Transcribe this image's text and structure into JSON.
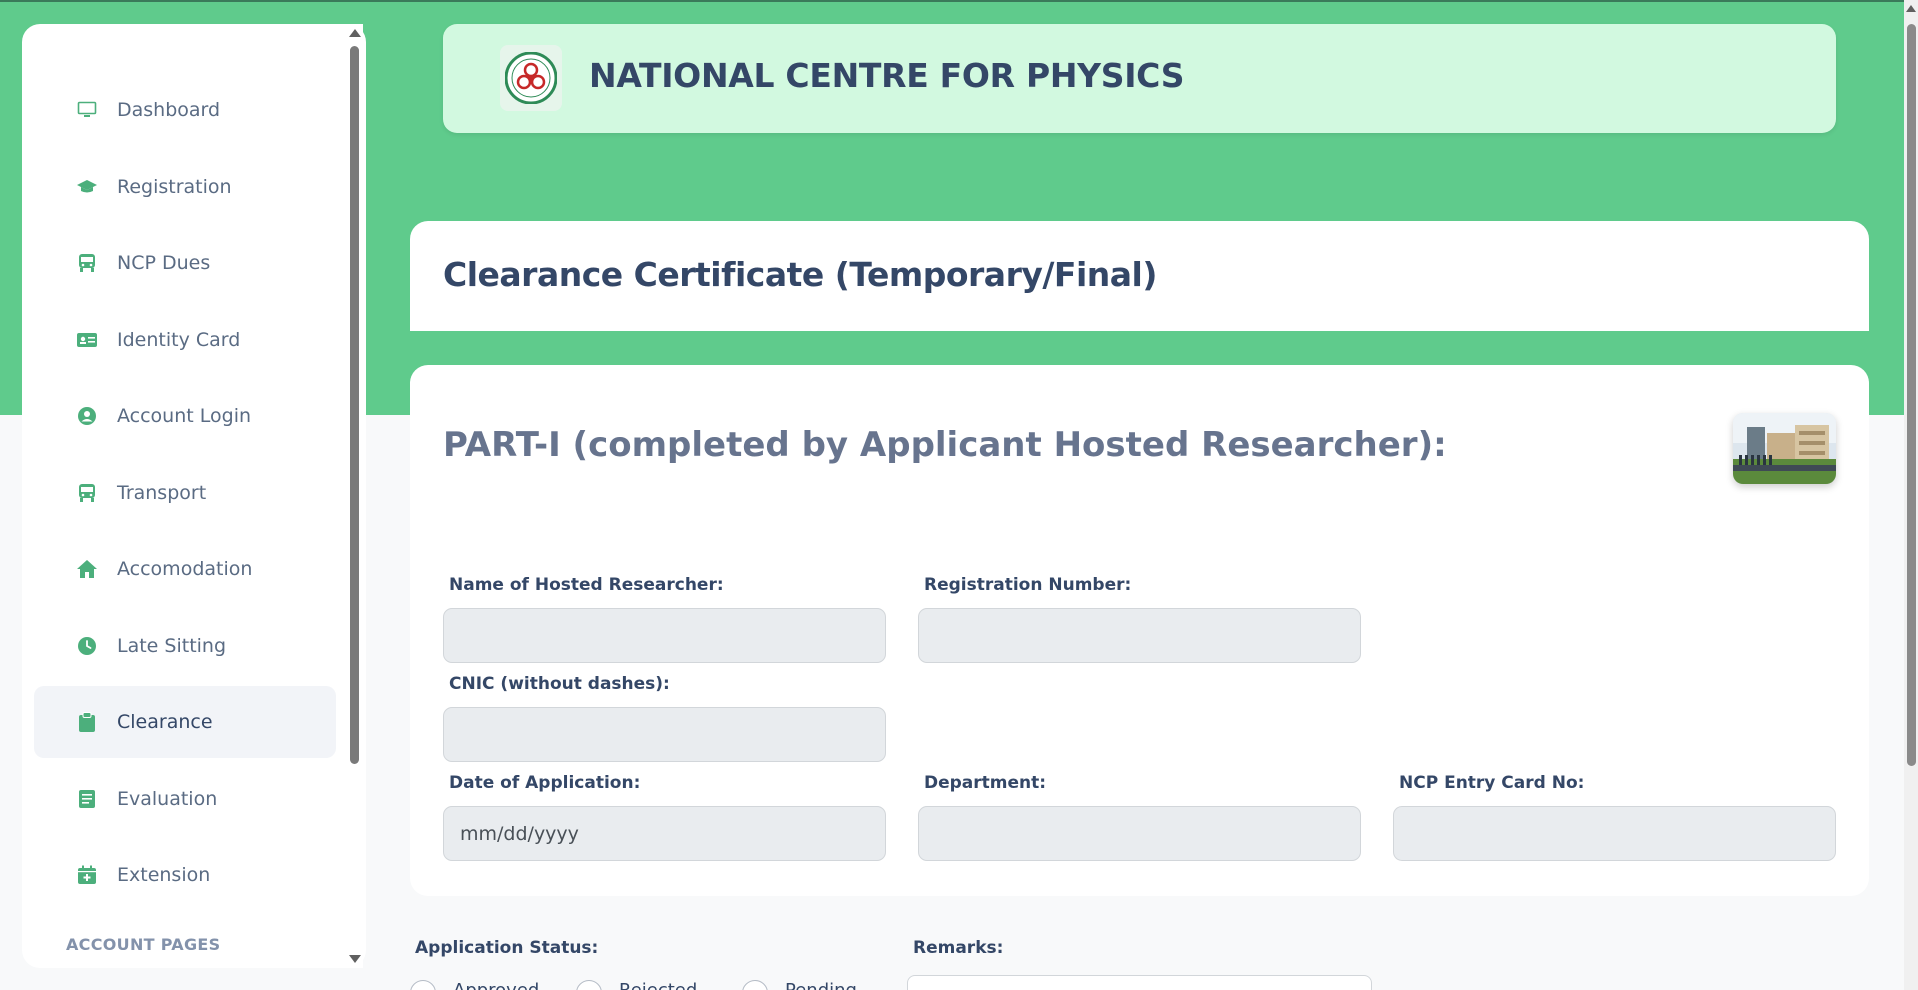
{
  "header": {
    "title": "NATIONAL CENTRE FOR PHYSICS"
  },
  "sidebar": {
    "items": [
      {
        "label": "Dashboard",
        "icon": "monitor-icon"
      },
      {
        "label": "Registration",
        "icon": "graduation-cap-icon"
      },
      {
        "label": "NCP Dues",
        "icon": "bus-icon"
      },
      {
        "label": "Identity Card",
        "icon": "id-card-icon"
      },
      {
        "label": "Account Login",
        "icon": "user-circle-icon"
      },
      {
        "label": "Transport",
        "icon": "bus-icon"
      },
      {
        "label": "Accomodation",
        "icon": "home-icon"
      },
      {
        "label": "Late Sitting",
        "icon": "clock-icon"
      },
      {
        "label": "Clearance",
        "icon": "clipboard-icon",
        "active": true
      },
      {
        "label": "Evaluation",
        "icon": "book-icon"
      },
      {
        "label": "Extension",
        "icon": "calendar-plus-icon"
      }
    ],
    "section_label": "ACCOUNT PAGES"
  },
  "page": {
    "title": "Clearance Certificate (Temporary/Final)",
    "part_title": "PART-I (completed by Applicant Hosted Researcher):"
  },
  "form": {
    "name_label": "Name of Hosted Researcher:",
    "name_value": "",
    "reg_label": "Registration Number:",
    "reg_value": "",
    "cnic_label": "CNIC (without dashes):",
    "cnic_value": "",
    "date_label": "Date of Application:",
    "date_value": "mm/dd/yyyy",
    "dept_label": "Department:",
    "dept_value": "",
    "entry_label": "NCP Entry Card No:",
    "entry_value": ""
  },
  "status": {
    "label": "Application Status:",
    "options": [
      "Approved",
      "Rejected",
      "Pending"
    ],
    "remarks_label": "Remarks:"
  },
  "colors": {
    "accent_green": "#5fcb8c",
    "header_bg": "#d2f9e0",
    "icon_green": "#4caf7c",
    "text_dark": "#344767"
  }
}
